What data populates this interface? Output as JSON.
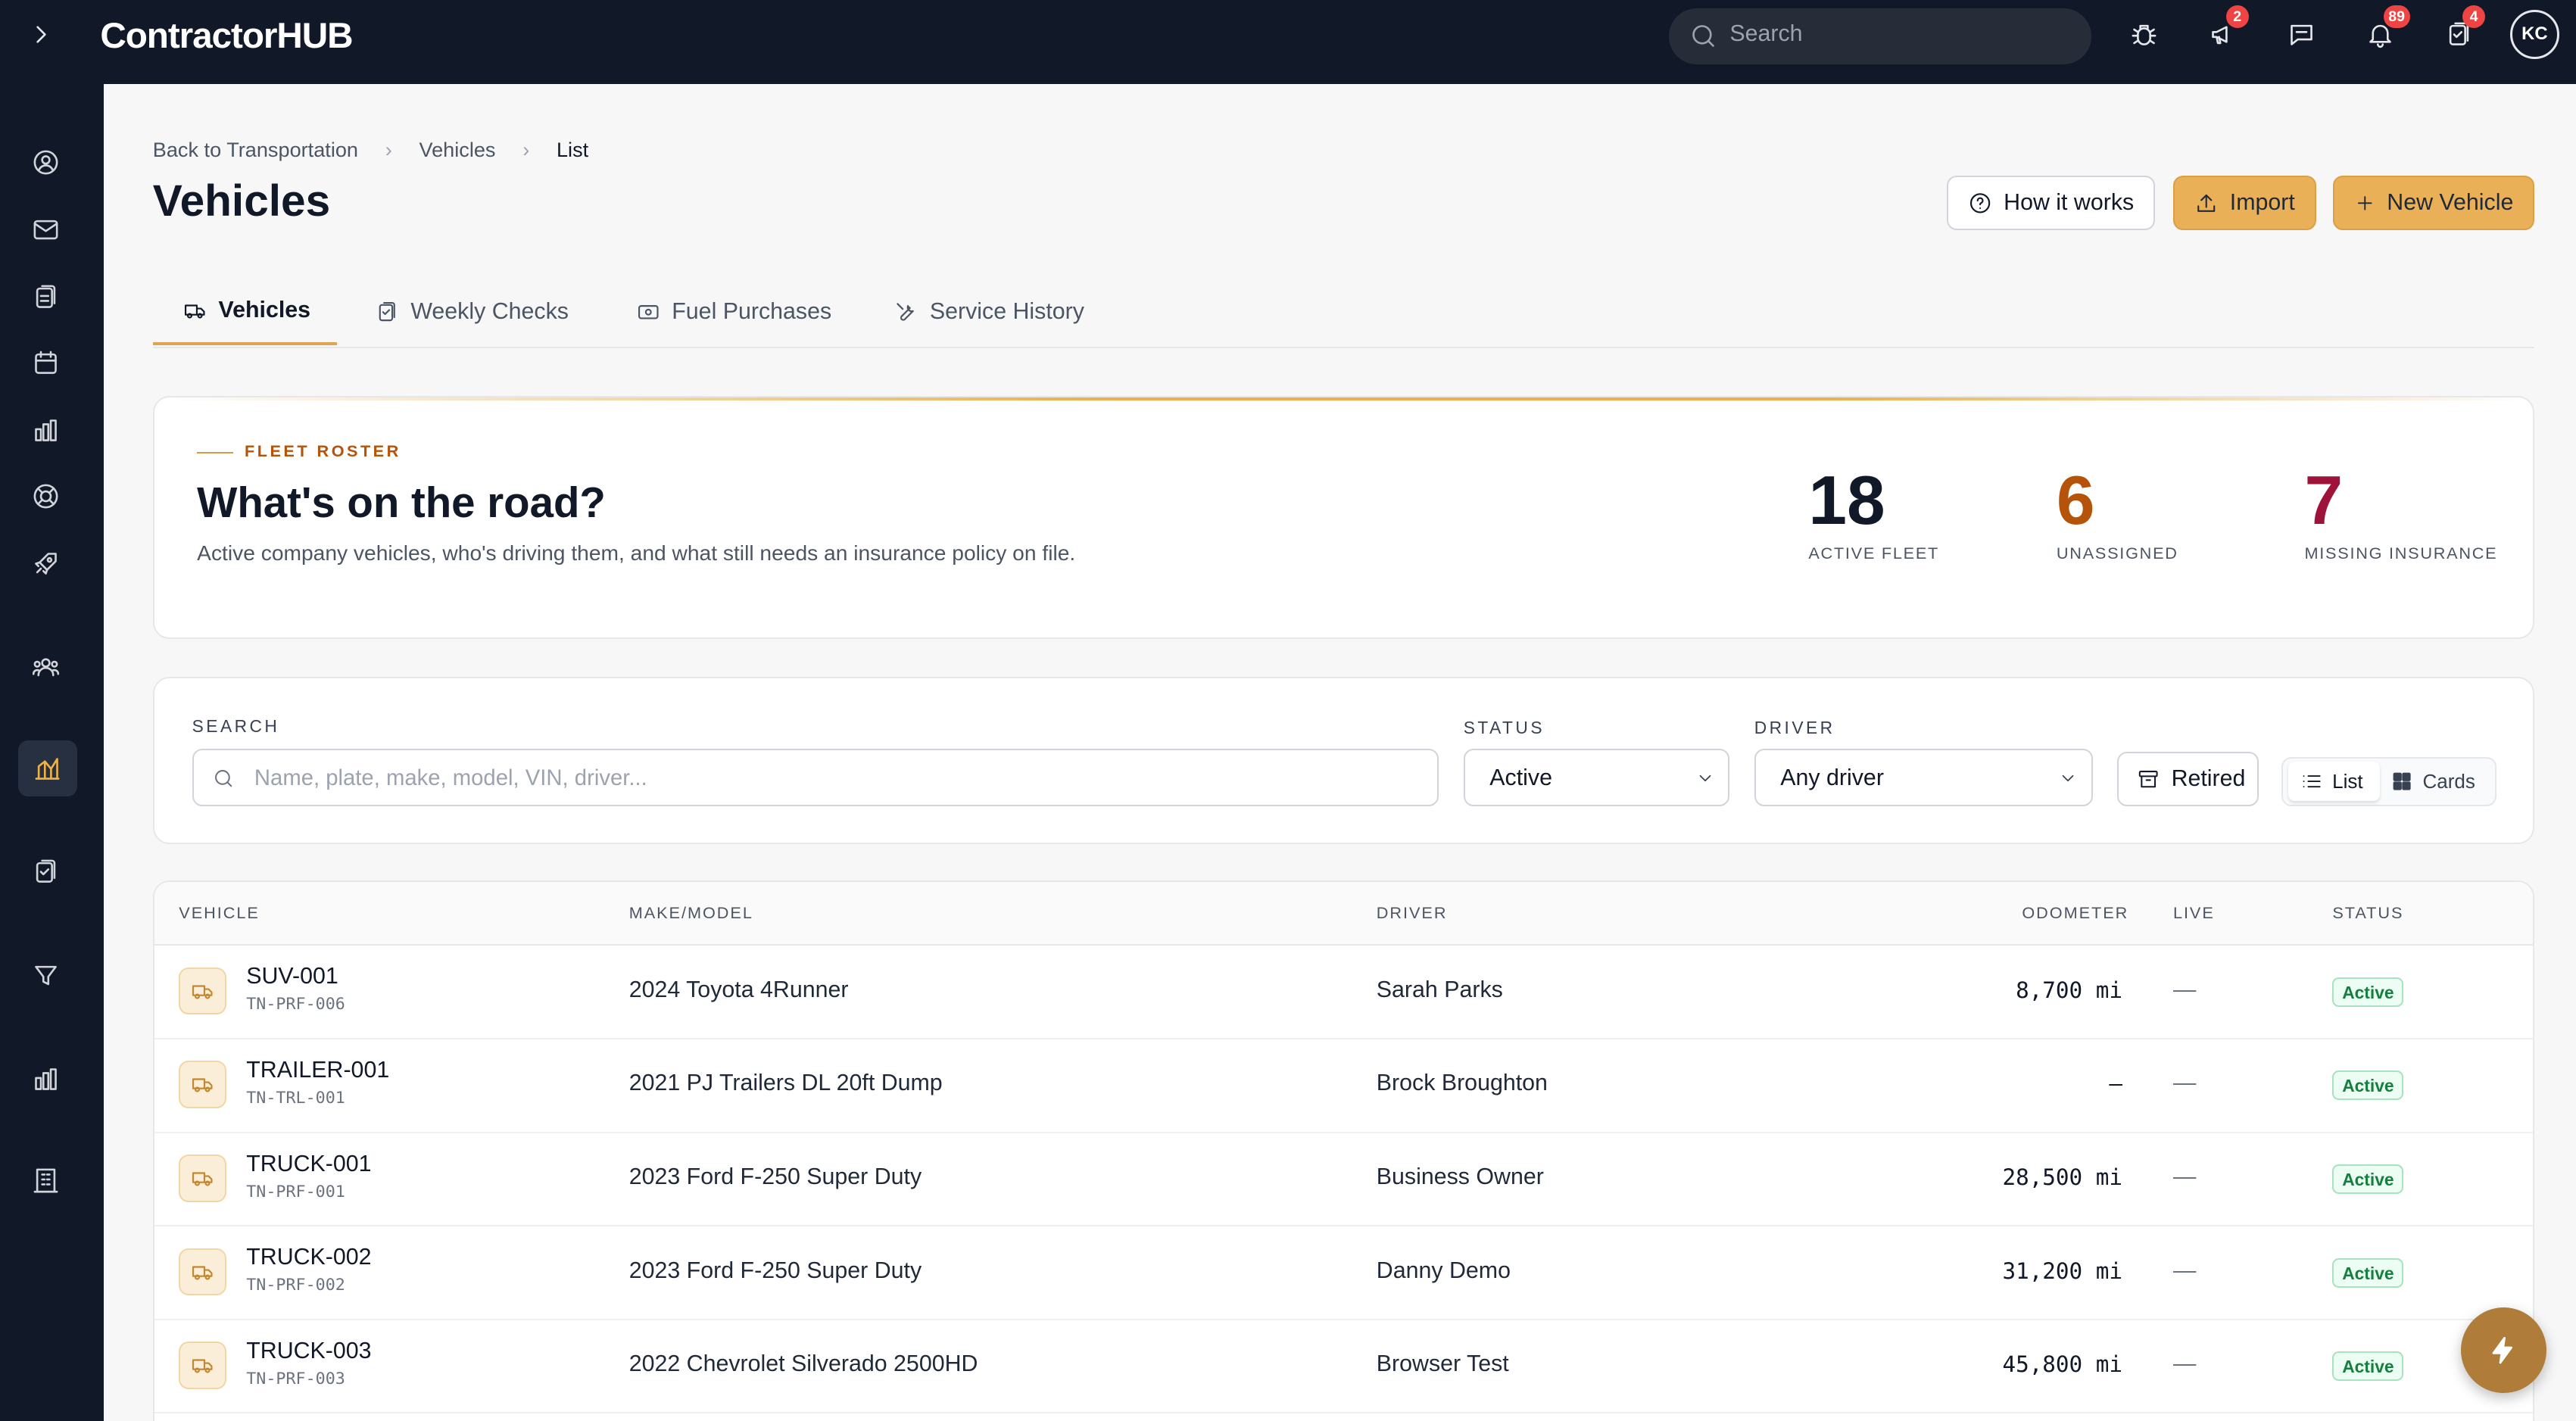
{
  "app": {
    "logo": "ContractorHUB"
  },
  "topbar": {
    "search_placeholder": "Search",
    "badges": {
      "announcements": "2",
      "notifications": "89",
      "tasks": "4"
    },
    "avatar_initials": "KC"
  },
  "breadcrumb": {
    "items": [
      "Back to Transportation",
      "Vehicles",
      "List"
    ]
  },
  "page": {
    "title": "Vehicles"
  },
  "actions": {
    "how": "How it works",
    "import": "Import",
    "new": "New Vehicle"
  },
  "tabs": [
    "Vehicles",
    "Weekly Checks",
    "Fuel Purchases",
    "Service History"
  ],
  "hero": {
    "kicker": "FLEET ROSTER",
    "title": "What's on the road?",
    "description": "Active company vehicles, who's driving them, and what still needs an insurance policy on file.",
    "stats": [
      {
        "value": "18",
        "label": "ACTIVE FLEET",
        "color": "#111827"
      },
      {
        "value": "6",
        "label": "UNASSIGNED",
        "color": "#b45309"
      },
      {
        "value": "7",
        "label": "MISSING INSURANCE",
        "color": "#9f1239"
      }
    ]
  },
  "filters": {
    "search_label": "SEARCH",
    "search_placeholder": "Name, plate, make, model, VIN, driver...",
    "status_label": "STATUS",
    "status_value": "Active",
    "driver_label": "DRIVER",
    "driver_value": "Any driver",
    "retired": "Retired",
    "view_list": "List",
    "view_cards": "Cards"
  },
  "table": {
    "columns": [
      "VEHICLE",
      "MAKE/MODEL",
      "DRIVER",
      "ODOMETER",
      "LIVE",
      "STATUS"
    ],
    "rows": [
      {
        "name": "SUV-001",
        "plate": "TN-PRF-006",
        "model": "2024 Toyota 4Runner",
        "driver": "Sarah Parks",
        "odometer": "8,700 mi",
        "live": "—",
        "status": "Active"
      },
      {
        "name": "TRAILER-001",
        "plate": "TN-TRL-001",
        "model": "2021 PJ Trailers DL 20ft Dump",
        "driver": "Brock Broughton",
        "odometer": "—",
        "live": "—",
        "status": "Active"
      },
      {
        "name": "TRUCK-001",
        "plate": "TN-PRF-001",
        "model": "2023 Ford F-250 Super Duty",
        "driver": "Business Owner",
        "odometer": "28,500 mi",
        "live": "—",
        "status": "Active"
      },
      {
        "name": "TRUCK-002",
        "plate": "TN-PRF-002",
        "model": "2023 Ford F-250 Super Duty",
        "driver": "Danny Demo",
        "odometer": "31,200 mi",
        "live": "—",
        "status": "Active"
      },
      {
        "name": "TRUCK-003",
        "plate": "TN-PRF-003",
        "model": "2022 Chevrolet Silverado 2500HD",
        "driver": "Browser Test",
        "odometer": "45,800 mi",
        "live": "—",
        "status": "Active"
      }
    ]
  },
  "sidebar": {
    "icons": [
      "user-circle-icon",
      "mail-icon",
      "clipboard-icon",
      "calendar-icon",
      "bar-chart-icon",
      "lifebuoy-icon",
      "rocket-icon",
      "team-icon",
      "fleet-chart-icon",
      "clipboard-check-icon",
      "filter-icon",
      "analytics-icon",
      "building-icon"
    ],
    "active": "fleet-chart-icon"
  },
  "colors": {
    "accent": "#eab058",
    "dark": "#111827",
    "status_green": "#15803d"
  }
}
